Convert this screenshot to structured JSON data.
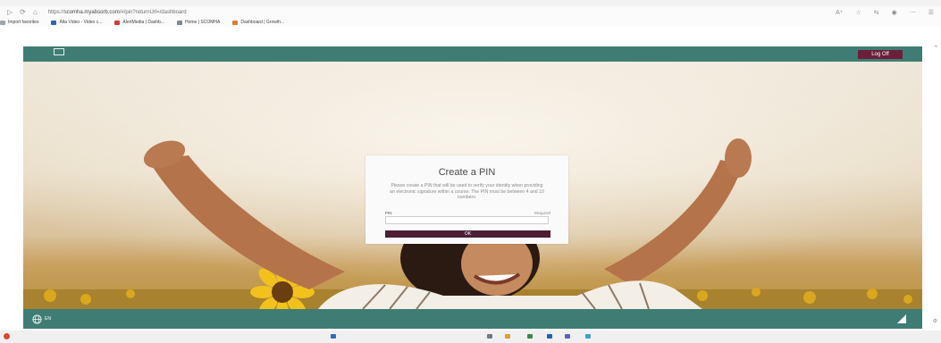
{
  "browser": {
    "url_prefix": "https://",
    "url_host": "scomha.myabsorb.com",
    "url_path": "/#/pin?returnUrl=/dashboard",
    "favorites": [
      {
        "label": "Import favorites",
        "color": "#9aa7b2"
      },
      {
        "label": "Alta Video - Video c...",
        "color": "#2f66b3"
      },
      {
        "label": "AlertMedia | Dashb...",
        "color": "#d13b3b"
      },
      {
        "label": "Home | SCOMHA",
        "color": "#7a8a99"
      },
      {
        "label": "Dashboard | Growth...",
        "color": "#e07a2f"
      }
    ]
  },
  "header": {
    "logo_text": "",
    "logoff_label": "Log Off"
  },
  "modal": {
    "title": "Create a PIN",
    "description": "Please create a PIN that will be used to verify your identity when providing an electronic signature within a course. The PIN must be between 4 and 10 numbers.",
    "pin_label": "PIN",
    "required_label": "Required",
    "pin_value": "",
    "ok_label": "OK"
  },
  "footer": {
    "language": "EN"
  },
  "colors": {
    "teal_bar": "#3f7d74",
    "logoff_bg": "#6b1f3a",
    "ok_bg": "#4e1f35"
  }
}
